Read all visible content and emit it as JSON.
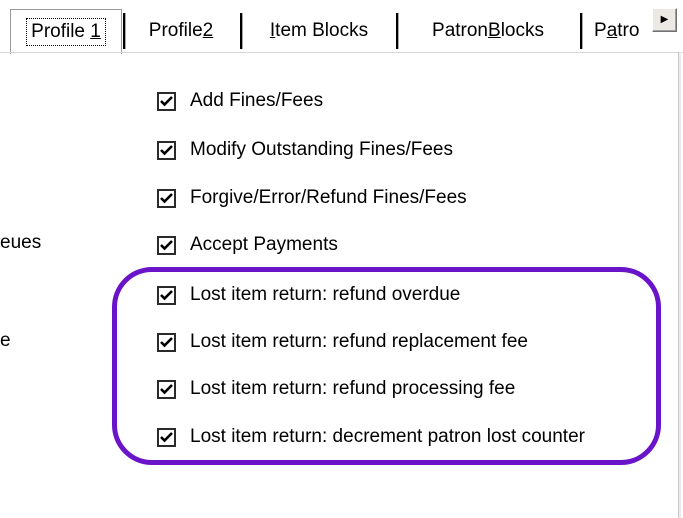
{
  "tabs": [
    {
      "pre": "Profile ",
      "ul": "1",
      "post": ""
    },
    {
      "pre": "Profile ",
      "ul": "2",
      "post": ""
    },
    {
      "pre": "",
      "ul": "I",
      "post": "tem Blocks"
    },
    {
      "pre": "Patron ",
      "ul": "B",
      "post": "locks"
    },
    {
      "pre": "P",
      "ul": "a",
      "post": "tro"
    }
  ],
  "left_labels": {
    "queues_fragment": "eues",
    "e_fragment": "e"
  },
  "permissions": [
    {
      "label": "Add Fines/Fees",
      "checked": true
    },
    {
      "label": "Modify Outstanding Fines/Fees",
      "checked": true
    },
    {
      "label": "Forgive/Error/Refund Fines/Fees",
      "checked": true
    },
    {
      "label": "Accept Payments",
      "checked": true
    },
    {
      "label": "Lost item return: refund overdue",
      "checked": true
    },
    {
      "label": "Lost item return: refund replacement fee",
      "checked": true
    },
    {
      "label": "Lost item return: refund processing fee",
      "checked": true
    },
    {
      "label": "Lost item return: decrement patron lost counter",
      "checked": true
    }
  ],
  "icons": {
    "tab_scroll": "right-arrow-icon",
    "checkbox": "checkmark-icon"
  },
  "colors": {
    "highlight": "#6a14c9"
  }
}
